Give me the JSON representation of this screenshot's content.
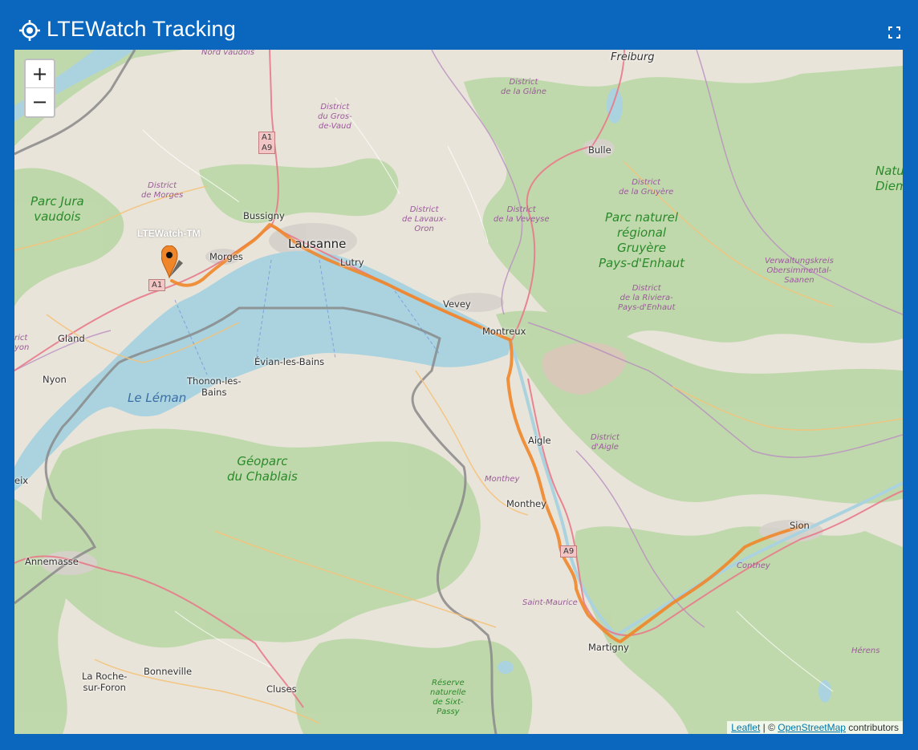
{
  "header": {
    "title": "LTEWatch Tracking"
  },
  "map": {
    "zoom_in_label": "+",
    "zoom_out_label": "−",
    "marker_label": "LTEWatch-TM",
    "attribution": {
      "leaflet": "Leaflet",
      "separator": " | © ",
      "osm": "OpenStreetMap",
      "suffix": " contributors"
    },
    "cities": {
      "lausanne": "Lausanne",
      "bussigny": "Bussigny",
      "morges": "Morges",
      "lutry": "Lutry",
      "vevey": "Vevey",
      "montreux": "Montreux",
      "gland": "Gland",
      "nyon": "Nyon",
      "evian": "Évian-les-Bains",
      "thonon": "Thonon-les-\nBains",
      "bulle": "Bulle",
      "freiburg": "Freiburg",
      "aigle": "Aigle",
      "monthey": "Monthey",
      "martigny": "Martigny",
      "sion": "Sion",
      "annemasse": "Annemasse",
      "bonneville": "Bonneville",
      "laroche": "La Roche-\nsur-Foron",
      "cluses": "Cluses"
    },
    "districts": {
      "nord_vaudois": "Nord vaudois",
      "glane": "District\nde la Glâne",
      "gros_de_vaud": "District\ndu Gros-\nde-Vaud",
      "morges": "District\nde Morges",
      "lavaux": "District\nde Lavaux-\nOron",
      "veveyse": "District\nde la Veveyse",
      "gruyere": "District\nde la Gruyère",
      "riviera": "District\nde la Riviera-\nPays-d'Enhaut",
      "obersimmental": "Verwaltungskreis\nObersimmental-\nSaanen",
      "aigle": "District\nd'Aigle",
      "monthey": "Monthey",
      "saint_maurice": "Saint-Maurice",
      "conthey": "Conthey",
      "herens": "Hérens",
      "nyon_partial": "rict\nyon"
    },
    "parks": {
      "jura": "Parc Jura\nvaudois",
      "gruyere": "Parc naturel\nrégional\nGruyère\nPays-d'Enhaut",
      "chablais": "Géoparc\ndu Chablais",
      "sixt": "Réserve\nnaturelle\nde Sixt-\nPassy",
      "diem": "Natu\nDiem"
    },
    "lake": "Le Léman",
    "shields": {
      "a1_west": "A1",
      "a1a9": "A1\nA9",
      "a9": "A9"
    },
    "edge_label": "eix",
    "colors": {
      "header": "#0a67bd",
      "track": "#f0862a",
      "lake": "#aad3df",
      "marker": "#f0862a"
    }
  }
}
